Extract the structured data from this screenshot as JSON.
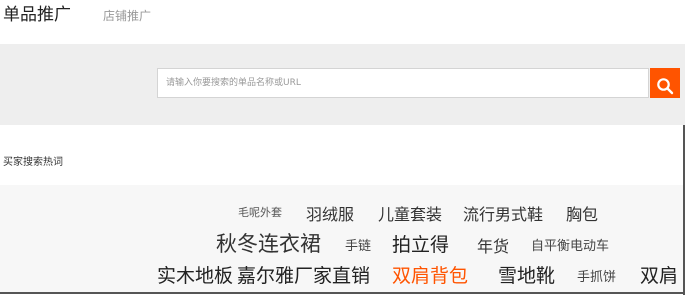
{
  "tabs": {
    "active": "单品推广",
    "inactive": "店铺推广"
  },
  "search": {
    "placeholder": "请输入你要搜索的单品名称或URL",
    "button_icon": "search-icon",
    "button_color": "#ff5400"
  },
  "hot": {
    "title": "买家搜索热词",
    "keywords": [
      "毛呢外套",
      "羽绒服",
      "儿童套装",
      "流行男式鞋",
      "胸包",
      "秋冬连衣裙",
      "手链",
      "拍立得",
      "年货",
      "自平衡电动车",
      "实木地板",
      "嘉尔雅厂家直销",
      "双肩背包",
      "雪地靴",
      "手抓饼",
      "双肩"
    ],
    "highlight_color": "#ff5400"
  }
}
